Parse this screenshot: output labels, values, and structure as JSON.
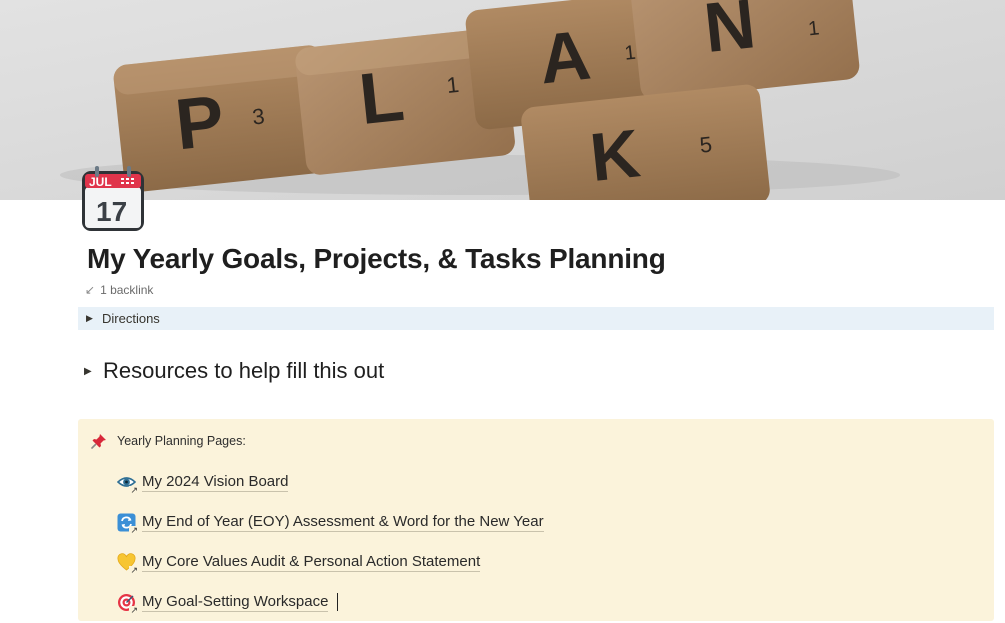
{
  "cover": {
    "tiles": [
      {
        "letter": "P",
        "score": "3"
      },
      {
        "letter": "L",
        "score": "1"
      },
      {
        "letter": "A",
        "score": "1"
      },
      {
        "letter": "N",
        "score": "1"
      },
      {
        "letter": "K",
        "score": "5"
      }
    ]
  },
  "page_icon": {
    "month": "JUL",
    "day": "17"
  },
  "title": "My Yearly Goals, Projects, & Tasks Planning",
  "backlink": "1 backlink",
  "directions": {
    "label": "Directions"
  },
  "resources": {
    "label": "Resources to help fill this out"
  },
  "callout": {
    "heading": "Yearly Planning Pages:",
    "links": [
      {
        "label": "My 2024 Vision Board",
        "icon": "eye-icon"
      },
      {
        "label": "My End of Year (EOY) Assessment & Word for the New Year",
        "icon": "refresh-icon"
      },
      {
        "label": "My Core Values Audit & Personal Action Statement",
        "icon": "yellow-heart-icon"
      },
      {
        "label": "My Goal-Setting Workspace",
        "icon": "target-icon"
      }
    ]
  },
  "colors": {
    "directions_bg": "#e8f1f8",
    "callout_bg": "#fbf3db",
    "calendar_red": "#e0344b"
  }
}
